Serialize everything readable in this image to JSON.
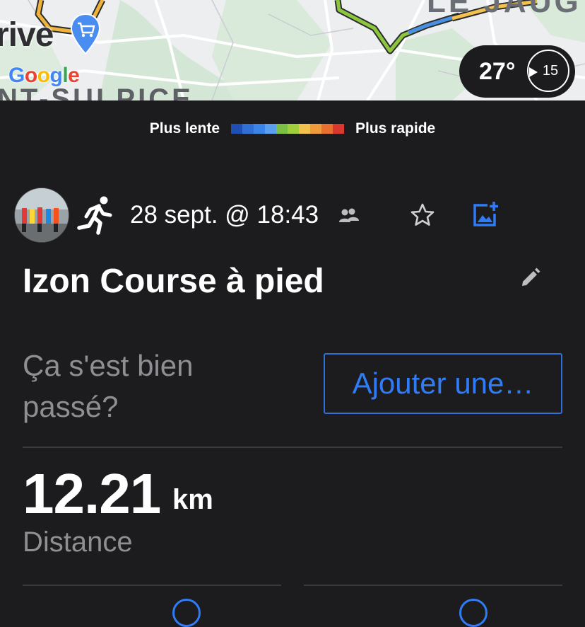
{
  "map": {
    "label_top": "LE JAUG",
    "label_left": "rive",
    "label_bottom": "NT-SULPICE",
    "google_logo": [
      "G",
      "o",
      "o",
      "g",
      "l",
      "e"
    ],
    "shop_pin_icon": "shopping-cart-icon",
    "weather": {
      "temperature": "27°",
      "wind_speed": "15",
      "wind_icon": "wind-direction-icon"
    }
  },
  "legend": {
    "slow_label": "Plus lente",
    "fast_label": "Plus rapide",
    "colors": [
      "#1f4fb4",
      "#2f6fd6",
      "#3c85e8",
      "#5aa0ef",
      "#7cc043",
      "#9fcf3a",
      "#f2c14e",
      "#ef9a3b",
      "#e8712f",
      "#d9382f"
    ]
  },
  "activity": {
    "sport_icon": "running-icon",
    "date": "28 sept. @ 18:43",
    "title": "Izon Course à pied",
    "feedback_prompt": "Ça s'est bien passé?",
    "add_button": "Ajouter une…",
    "distance": {
      "value": "12.21",
      "unit": "km",
      "label": "Distance"
    }
  }
}
